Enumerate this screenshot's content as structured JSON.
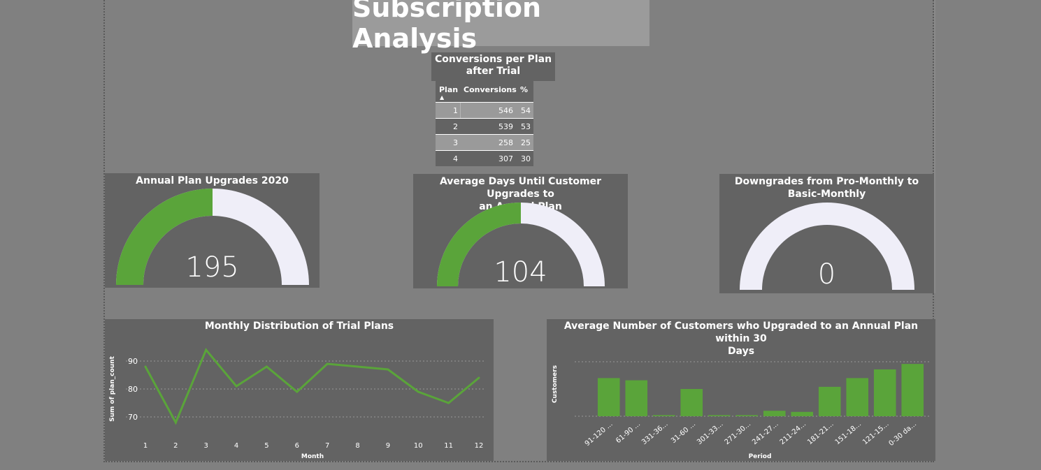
{
  "page": {
    "title": "Subscription Analysis"
  },
  "table": {
    "title_line1": "Conversions per Plan",
    "title_line2": "after Trial",
    "headers": {
      "plan": "Plan",
      "conversions": "Conversions",
      "pct": "%"
    },
    "sort_indicator": "sort-ascending-icon",
    "rows": [
      {
        "plan": "1",
        "conversions": "546",
        "pct": "54"
      },
      {
        "plan": "2",
        "conversions": "539",
        "pct": "53"
      },
      {
        "plan": "3",
        "conversions": "258",
        "pct": "25"
      },
      {
        "plan": "4",
        "conversions": "307",
        "pct": "30"
      }
    ]
  },
  "gauges": [
    {
      "title_line1": "Annual Plan Upgrades 2020",
      "title_line2": "",
      "value": "195",
      "fill_fraction": 0.5
    },
    {
      "title_line1": "Average Days Until Customer Upgrades to",
      "title_line2": "an Annual Plan",
      "value": "104",
      "fill_fraction": 0.5
    },
    {
      "title_line1": "Downgrades from Pro-Monthly to",
      "title_line2": "Basic-Monthly",
      "value": "0",
      "fill_fraction": 0
    }
  ],
  "colors": {
    "green": "#5aa43a",
    "gauge_track": "#efeef8",
    "panel": "#636363",
    "background": "#808080"
  },
  "chart_data": [
    {
      "type": "line",
      "title": "Monthly Distribution of Trial Plans",
      "xlabel": "Month",
      "ylabel": "Sum of plan_count",
      "x": [
        1,
        2,
        3,
        4,
        5,
        6,
        7,
        8,
        9,
        10,
        11,
        12
      ],
      "series": [
        {
          "values": [
            88,
            68,
            94,
            81,
            88,
            79,
            89,
            88,
            87,
            79,
            75,
            84
          ]
        }
      ],
      "yticks": [
        70,
        80,
        90
      ],
      "ylim": [
        64,
        96
      ],
      "grid": true
    },
    {
      "type": "bar",
      "title_line1": "Average Number of Customers who Upgraded to an Annual Plan within 30",
      "title_line2": "Days",
      "xlabel": "Period",
      "ylabel": "Customers",
      "categories": [
        "91-120 ...",
        "61-90 ...",
        "331-36...",
        "31-60 ...",
        "301-33...",
        "271-30...",
        "241-27...",
        "211-24...",
        "181-21...",
        "151-18...",
        "121-15...",
        "0-30 da..."
      ],
      "values": [
        35,
        33,
        1,
        25,
        1,
        1,
        5,
        4,
        27,
        35,
        43,
        48
      ],
      "ylim": [
        0,
        50
      ],
      "grid": true
    }
  ]
}
